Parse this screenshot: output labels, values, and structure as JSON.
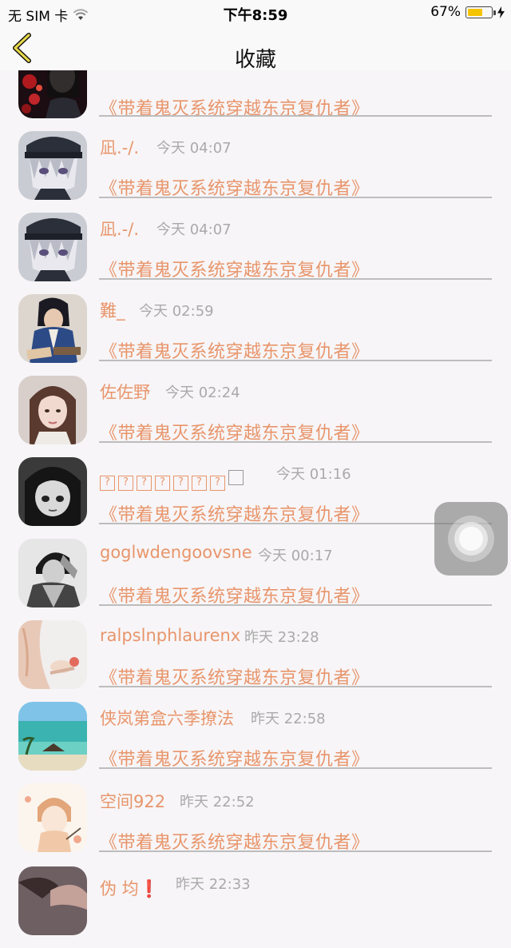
{
  "status_bar": {
    "carrier": "无 SIM 卡",
    "wifi_icon": "wifi-icon",
    "time": "下午8:59",
    "battery_percent": "67%",
    "battery_level": 0.67,
    "charging_icon": "bolt-icon"
  },
  "nav": {
    "back_icon": "chevron-left-icon",
    "title": "收藏"
  },
  "items": [
    {
      "name": "",
      "time": "",
      "book": "《带着鬼灭系统穿越东京复仇者》",
      "avatar": "avatar-red-flowers"
    },
    {
      "name": "凪.-/.",
      "time": "今天 04:07",
      "book": "《带着鬼灭系统穿越东京复仇者》",
      "avatar": "avatar-anime-cap"
    },
    {
      "name": "凪.-/.",
      "time": "今天 04:07",
      "book": "《带着鬼灭系统穿越东京复仇者》",
      "avatar": "avatar-anime-cap"
    },
    {
      "name": "難_",
      "time": "今天 02:59",
      "book": "《带着鬼灭系统穿越东京复仇者》",
      "avatar": "avatar-anime-kimono"
    },
    {
      "name": "佐佐野",
      "time": "今天 02:24",
      "book": "《带着鬼灭系统穿越东京复仇者》",
      "avatar": "avatar-girl-photo"
    },
    {
      "name": "",
      "time": "今天 01:16",
      "book": "《带着鬼灭系统穿越东京复仇者》",
      "avatar": "avatar-anime-gray"
    },
    {
      "name": "goglwdengoovsne",
      "time": "今天 00:17",
      "book": "《带着鬼灭系统穿越东京复仇者》",
      "avatar": "avatar-bw-photo"
    },
    {
      "name": "ralpslnphlaurenx",
      "time": "昨天 23:28",
      "book": "《带着鬼灭系统穿越东京复仇者》",
      "avatar": "avatar-hand-flower"
    },
    {
      "name": "侠岚第盒六季撩法",
      "time": "昨天 22:58",
      "book": "《带着鬼灭系统穿越东京复仇者》",
      "avatar": "avatar-beach"
    },
    {
      "name": "空间922",
      "time": "昨天 22:52",
      "book": "《带着鬼灭系统穿越东京复仇者》",
      "avatar": "avatar-anime-sketch"
    },
    {
      "name": "伪 均",
      "name_suffix": "❗",
      "time": "昨天 22:33",
      "book": "",
      "avatar": "avatar-dark-photo"
    }
  ],
  "assistive_touch": "assistive-touch-icon"
}
